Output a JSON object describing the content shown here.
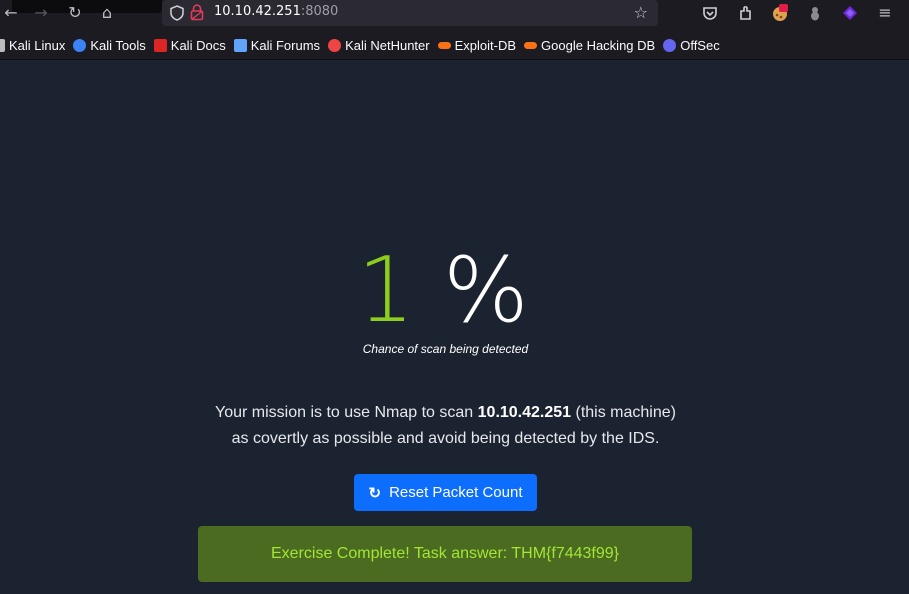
{
  "browser": {
    "url_host": "10.10.42.251",
    "url_port": ":8080",
    "bookmarks": [
      {
        "label": "Kali Linux",
        "icon": "kali-icon",
        "color": "#bbbbbb"
      },
      {
        "label": "Kali Tools",
        "icon": "kali-tools-icon",
        "color": "#3b82f6"
      },
      {
        "label": "Kali Docs",
        "icon": "kali-docs-icon",
        "color": "#dc2626"
      },
      {
        "label": "Kali Forums",
        "icon": "kali-forums-icon",
        "color": "#60a5fa"
      },
      {
        "label": "Kali NetHunter",
        "icon": "nethunter-icon",
        "color": "#ef4444"
      },
      {
        "label": "Exploit-DB",
        "icon": "exploit-db-icon",
        "color": "#f97316"
      },
      {
        "label": "Google Hacking DB",
        "icon": "ghdb-icon",
        "color": "#f97316"
      },
      {
        "label": "OffSec",
        "icon": "offsec-icon",
        "color": "#6366f1"
      }
    ]
  },
  "page": {
    "percent_value": "1",
    "percent_sign": "%",
    "caption": "Chance of scan being detected",
    "mission_prefix": "Your mission is to use Nmap to scan ",
    "mission_ip": "10.10.42.251",
    "mission_suffix": " (this machine)",
    "mission_line2": "as covertly as possible and avoid being detected by the IDS.",
    "reset_label": "Reset Packet Count",
    "alert_text": "Exercise Complete! Task answer: THM{f7443f99}"
  },
  "colors": {
    "page_bg": "#1c2330",
    "percent_green": "#8ccd1e",
    "button_blue": "#0d6efd",
    "alert_bg": "#4b6b21",
    "alert_text": "#a3e635"
  }
}
